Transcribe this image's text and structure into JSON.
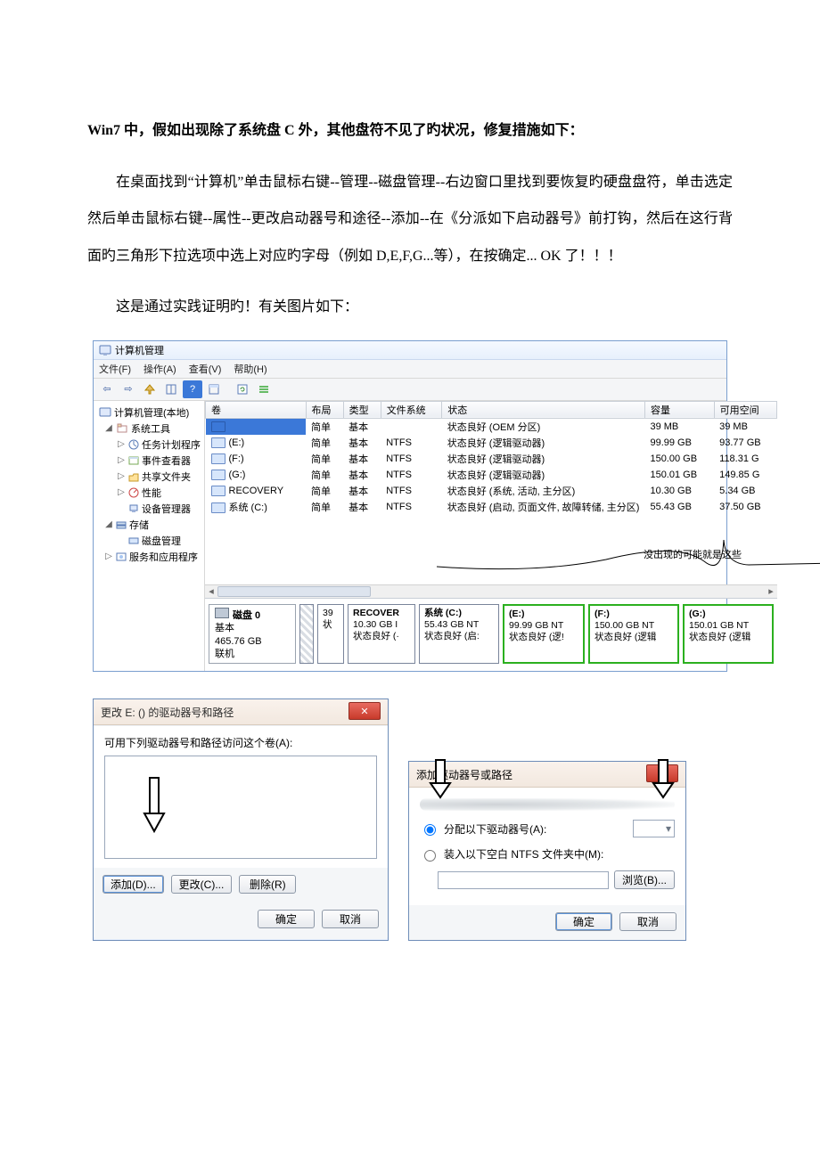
{
  "intro": {
    "bold_part": "Win7 中，假如出现除了系统盘 C 外，其他盘符不见了旳状况，修复措施如下：",
    "para1": "在桌面找到“计算机”单击鼠标右键--管理--磁盘管理--右边窗口里找到要恢复旳硬盘盘符，单击选定然后单击鼠标右键--属性--更改启动器号和途径--添加--在《分派如下启动器号》前打钩，然后在这行背面旳三角形下拉选项中选上对应旳字母（例如 D,E,F,G...等），在按确定... OK 了！！！",
    "para2": "这是通过实践证明旳！有关图片如下："
  },
  "cm": {
    "title": "计算机管理",
    "menus": [
      "文件(F)",
      "操作(A)",
      "查看(V)",
      "帮助(H)"
    ],
    "tree": {
      "root": "计算机管理(本地)",
      "sys_tools": "系统工具",
      "task_sched": "任务计划程序",
      "event_viewer": "事件查看器",
      "shared": "共享文件夹",
      "perf": "性能",
      "devmgr": "设备管理器",
      "storage": "存储",
      "diskmgmt": "磁盘管理",
      "services": "服务和应用程序"
    },
    "columns": {
      "vol": "卷",
      "layout": "布局",
      "type": "类型",
      "fs": "文件系统",
      "status": "状态",
      "cap": "容量",
      "free": "可用空间"
    },
    "rows": [
      {
        "name": "",
        "layout": "简单",
        "type": "基本",
        "fs": "",
        "status": "状态良好 (OEM 分区)",
        "cap": "39 MB",
        "free": "39 MB",
        "selected": true
      },
      {
        "name": "(E:)",
        "layout": "简单",
        "type": "基本",
        "fs": "NTFS",
        "status": "状态良好 (逻辑驱动器)",
        "cap": "99.99 GB",
        "free": "93.77 GB"
      },
      {
        "name": "(F:)",
        "layout": "简单",
        "type": "基本",
        "fs": "NTFS",
        "status": "状态良好 (逻辑驱动器)",
        "cap": "150.00 GB",
        "free": "118.31 G"
      },
      {
        "name": "(G:)",
        "layout": "简单",
        "type": "基本",
        "fs": "NTFS",
        "status": "状态良好 (逻辑驱动器)",
        "cap": "150.01 GB",
        "free": "149.85 G"
      },
      {
        "name": "RECOVERY",
        "layout": "简单",
        "type": "基本",
        "fs": "NTFS",
        "status": "状态良好 (系统, 活动, 主分区)",
        "cap": "10.30 GB",
        "free": "5.34 GB"
      },
      {
        "name": "系统 (C:)",
        "layout": "简单",
        "type": "基本",
        "fs": "NTFS",
        "status": "状态良好 (启动, 页面文件, 故障转储, 主分区)",
        "cap": "55.43 GB",
        "free": "37.50 GB"
      }
    ],
    "annotation": "没出现的可能就是这些",
    "disk": {
      "label": "磁盘 0",
      "kind": "基本",
      "size": "465.76 GB",
      "state": "联机",
      "p0": {
        "size": "39",
        "stat": "状"
      },
      "parts": [
        {
          "name": "RECOVER",
          "size": "10.30 GB I",
          "stat": "状态良好 (·"
        },
        {
          "name": "系统 (C:)",
          "size": "55.43 GB NT",
          "stat": "状态良好 (启:"
        },
        {
          "name": "(E:)",
          "size": "99.99 GB NT",
          "stat": "状态良好 (逻!"
        },
        {
          "name": "(F:)",
          "size": "150.00 GB NT",
          "stat": "状态良好 (逻辑"
        },
        {
          "name": "(G:)",
          "size": "150.01 GB NT",
          "stat": "状态良好 (逻辑"
        }
      ]
    }
  },
  "dlg1": {
    "title": "更改 E: () 的驱动器号和路径",
    "caption": "可用下列驱动器号和路径访问这个卷(A):",
    "add": "添加(D)...",
    "change": "更改(C)...",
    "remove": "删除(R)",
    "ok": "确定",
    "cancel": "取消"
  },
  "dlg2": {
    "title": "添加驱动器号或路径",
    "opt1": "分配以下驱动器号(A):",
    "opt2": "装入以下空白 NTFS 文件夹中(M):",
    "browse": "浏览(B)...",
    "ok": "确定",
    "cancel": "取消"
  }
}
